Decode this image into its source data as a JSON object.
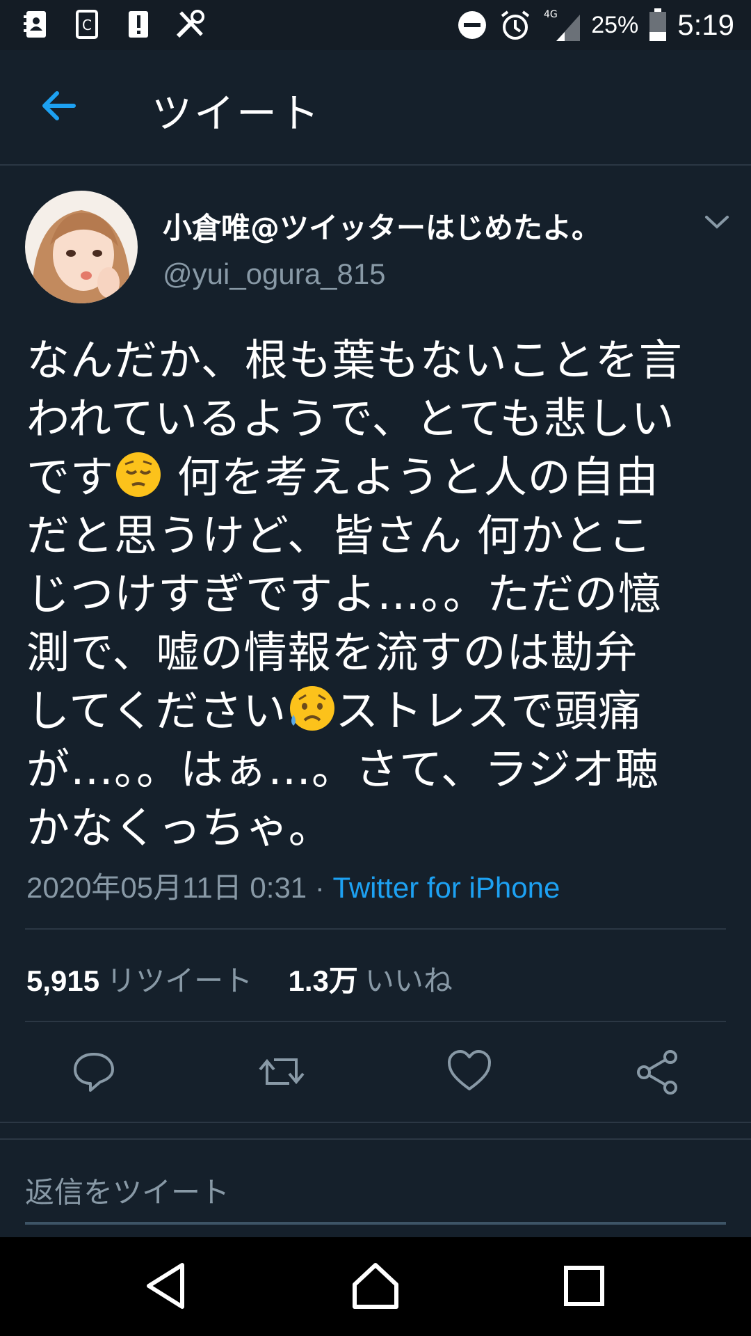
{
  "status_bar": {
    "battery_percent": "25%",
    "time": "5:19",
    "network": "4G",
    "icons": [
      "contacts-icon",
      "clipboard-icon",
      "alert-icon",
      "tools-icon",
      "dnd-icon",
      "alarm-icon",
      "signal-icon",
      "battery-icon"
    ]
  },
  "header": {
    "title": "ツイート",
    "back_icon": "arrow-left-icon"
  },
  "tweet": {
    "author_name": "小倉唯@ツイッターはじめたよ。",
    "handle": "@yui_ogura_815",
    "text_lines": [
      {
        "a": "なんだか、根も葉もないことを言",
        "emoji": "",
        "b": ""
      },
      {
        "a": "われているようで、とても悲しい",
        "emoji": "",
        "b": ""
      },
      {
        "a": "です",
        "emoji": "pensive",
        "b": " 何を考えようと人の自由"
      },
      {
        "a": "だと思うけど、皆さん 何かとこ",
        "emoji": "",
        "b": ""
      },
      {
        "a": "じつけすぎですよ…。。ただの憶",
        "emoji": "",
        "b": ""
      },
      {
        "a": "測で、嘘の情報を流すのは勘弁",
        "emoji": "",
        "b": ""
      },
      {
        "a": "してください",
        "emoji": "sad-sweat",
        "b": "ストレスで頭痛"
      },
      {
        "a": "が…。。はぁ…。さて、ラジオ聴",
        "emoji": "",
        "b": ""
      },
      {
        "a": "かなくっちゃ。",
        "emoji": "",
        "b": ""
      }
    ],
    "timestamp": "2020年05月11日 0:31",
    "separator": " · ",
    "source": "Twitter for iPhone",
    "retweet_count": "5,915",
    "retweet_label": "リツイート",
    "like_count": "1.3万",
    "like_label": "いいね"
  },
  "reply": {
    "placeholder": "返信をツイート"
  },
  "colors": {
    "background": "#15202b",
    "accent": "#1da1f2",
    "muted": "#8899a6",
    "divider": "#2b3744"
  }
}
